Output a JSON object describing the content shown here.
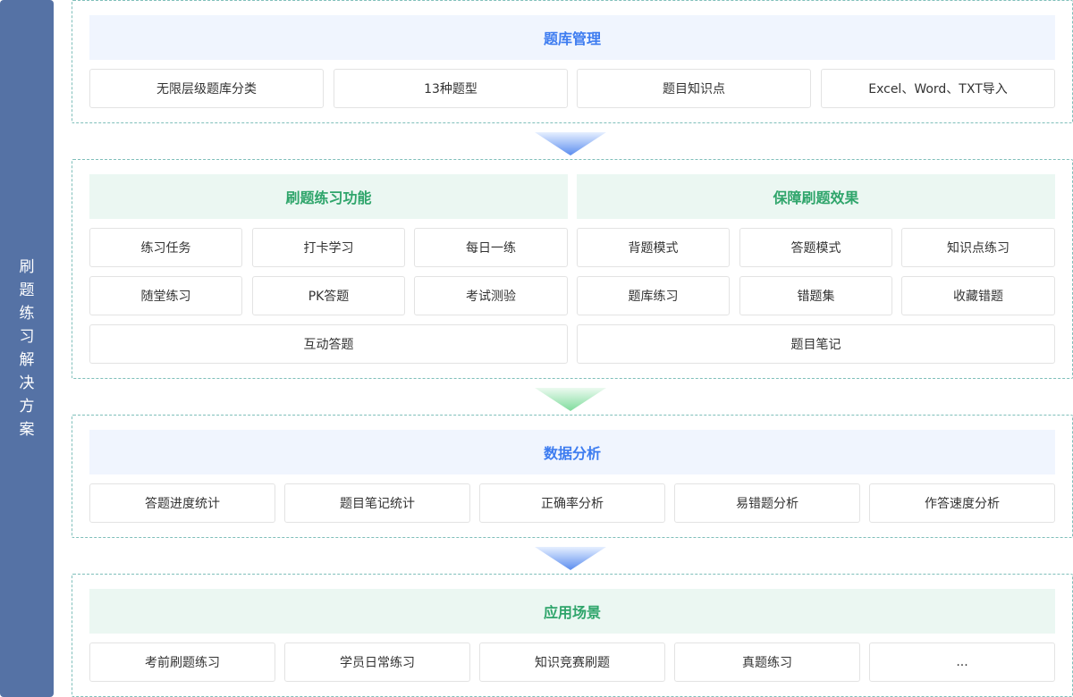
{
  "sidebar": {
    "title": "刷题练习解决方案",
    "color": "#5572a5"
  },
  "sections": {
    "bank": {
      "title": "题库管理",
      "items": [
        "无限层级题库分类",
        "13种题型",
        "题目知识点",
        "Excel、Word、TXT导入"
      ]
    },
    "practice": {
      "left": {
        "title": "刷题练习功能",
        "items": [
          "练习任务",
          "打卡学习",
          "每日一练",
          "随堂练习",
          "PK答题",
          "考试测验",
          "互动答题"
        ]
      },
      "right": {
        "title": "保障刷题效果",
        "items": [
          "背题模式",
          "答题模式",
          "知识点练习",
          "题库练习",
          "错题集",
          "收藏错题",
          "题目笔记"
        ]
      }
    },
    "analysis": {
      "title": "数据分析",
      "items": [
        "答题进度统计",
        "题目笔记统计",
        "正确率分析",
        "易错题分析",
        "作答速度分析"
      ]
    },
    "scenarios": {
      "title": "应用场景",
      "items": [
        "考前刷题练习",
        "学员日常练习",
        "知识竞赛刷题",
        "真题练习",
        "..."
      ]
    }
  },
  "colors": {
    "blue_header_bg": "#f0f5fe",
    "blue_header_text": "#3d7cf0",
    "green_header_bg": "#ebf7f2",
    "green_header_text": "#2fa56b",
    "dashed_border": "#7fbfba"
  },
  "arrows": [
    "blue-chevron",
    "green-chevron",
    "blue-chevron"
  ]
}
